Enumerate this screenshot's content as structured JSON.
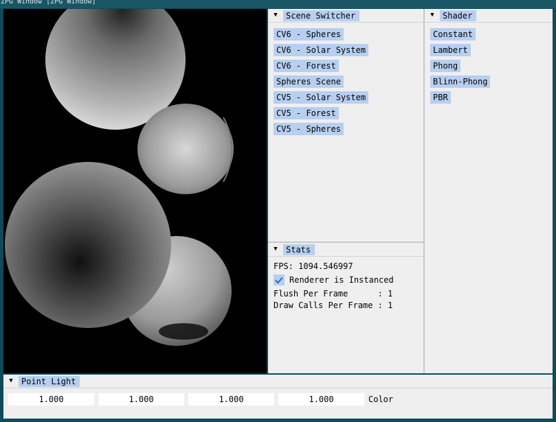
{
  "window": {
    "title": "ZPG Window [ZPG Window]"
  },
  "scene_switcher": {
    "title": "Scene Switcher",
    "items": [
      "CV6 - Spheres",
      "CV6 - Solar System",
      "CV6 - Forest",
      "Spheres Scene",
      "CV5 - Solar System",
      "CV5 - Forest",
      "CV5 - Spheres"
    ]
  },
  "shader": {
    "title": "Shader",
    "items": [
      "Constant",
      "Lambert",
      "Phong",
      "Blinn-Phong",
      "PBR"
    ]
  },
  "stats": {
    "title": "Stats",
    "fps": "FPS: 1094.546997",
    "renderer_instanced_label": "Renderer is Instanced",
    "renderer_instanced_checked": true,
    "flush_per_frame": "Flush Per Frame      : 1",
    "draw_calls_per_frame": "Draw Calls Per Frame : 1"
  },
  "point_light": {
    "title": "Point Light",
    "color_values": [
      "1.000",
      "1.000",
      "1.000",
      "1.000"
    ],
    "color_label": "Color"
  },
  "colors": {
    "accent": "#b7cff0",
    "panel_bg": "#efefef",
    "window_frame": "#0e4a5a"
  }
}
